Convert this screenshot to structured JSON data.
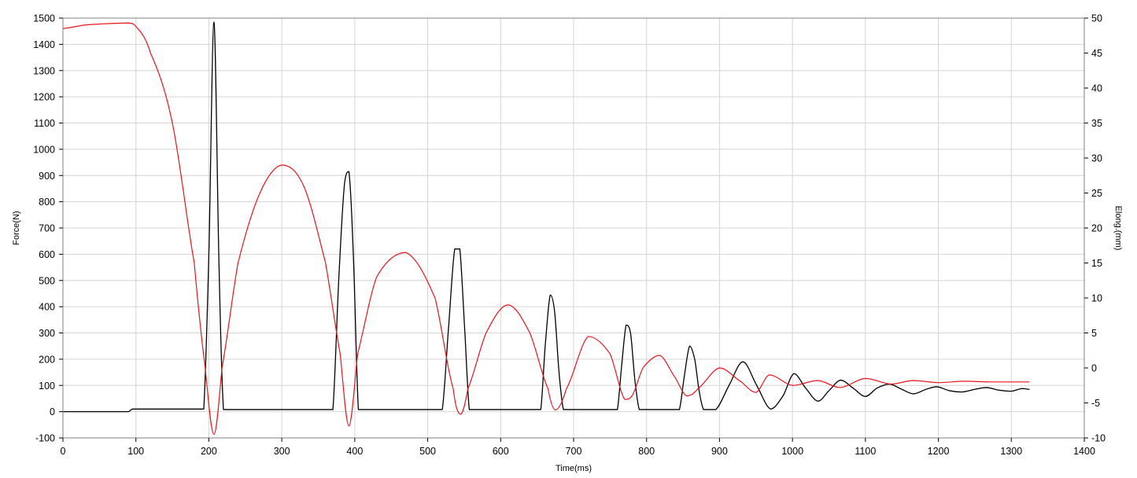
{
  "chart_data": {
    "type": "line",
    "xlabel": "Time(ms)",
    "ylabel_left": "Force(N)",
    "ylabel_right": "Elong.(mm)",
    "xlim": [
      0,
      1400
    ],
    "ylim_left": [
      -100,
      1500
    ],
    "ylim_right": [
      -10,
      50
    ],
    "x_ticks": [
      0,
      100,
      200,
      300,
      400,
      500,
      600,
      700,
      800,
      900,
      1000,
      1100,
      1200,
      1300,
      1400
    ],
    "y_left_ticks": [
      -100,
      0,
      100,
      200,
      300,
      400,
      500,
      600,
      700,
      800,
      900,
      1000,
      1100,
      1200,
      1300,
      1400,
      1500
    ],
    "y_right_ticks": [
      -10,
      -5,
      0,
      5,
      10,
      15,
      20,
      25,
      30,
      35,
      40,
      45,
      50
    ],
    "grid": true,
    "colors": {
      "force": "#000000",
      "elongation": "#e8141b",
      "grid": "#d4d4d4",
      "frame": "#808080"
    },
    "series": [
      {
        "axis": "left",
        "color": "#000000",
        "x": [
          0,
          90,
          95,
          190,
          193,
          200,
          207,
          214,
          220,
          225,
          370,
          378,
          386,
          392,
          398,
          405,
          410,
          520,
          528,
          537,
          544,
          551,
          557,
          563,
          655,
          661,
          668,
          674,
          680,
          686,
          760,
          766,
          772,
          778,
          784,
          790,
          845,
          852,
          859,
          866,
          872,
          878,
          895,
          913,
          932,
          951,
          970,
          987,
          1002,
          1018,
          1035,
          1050,
          1066,
          1083,
          1100,
          1116,
          1133,
          1150,
          1166,
          1183,
          1198,
          1215,
          1232,
          1250,
          1266,
          1283,
          1300,
          1315,
          1325
        ],
        "y": [
          0,
          0,
          10,
          10,
          10,
          600,
          1485,
          550,
          8,
          8,
          8,
          500,
          870,
          915,
          600,
          8,
          8,
          8,
          300,
          620,
          620,
          300,
          8,
          8,
          8,
          250,
          445,
          380,
          150,
          8,
          8,
          180,
          330,
          300,
          120,
          8,
          8,
          140,
          250,
          200,
          80,
          8,
          8,
          100,
          190,
          100,
          10,
          60,
          145,
          90,
          40,
          80,
          120,
          90,
          58,
          90,
          105,
          85,
          68,
          85,
          95,
          80,
          75,
          85,
          92,
          82,
          78,
          88,
          85
        ]
      },
      {
        "axis": "right",
        "color": "#e8141b",
        "x": [
          0,
          30,
          60,
          90,
          100,
          120,
          150,
          180,
          195,
          207,
          218,
          240,
          270,
          300,
          330,
          360,
          380,
          392,
          404,
          430,
          470,
          510,
          535,
          545,
          555,
          580,
          610,
          640,
          665,
          675,
          690,
          720,
          750,
          770,
          780,
          795,
          818,
          840,
          855,
          870,
          900,
          930,
          950,
          968,
          1000,
          1035,
          1065,
          1100,
          1135,
          1165,
          1200,
          1235,
          1270,
          1300,
          1325
        ],
        "y": [
          48.5,
          49,
          49.2,
          49.3,
          48.8,
          45,
          35,
          15,
          0,
          -9.5,
          0,
          15,
          25,
          29,
          26,
          15,
          2,
          -8.3,
          2,
          13,
          16.5,
          10,
          -3,
          -6.6,
          -3,
          5,
          9,
          5,
          -3,
          -6,
          -3,
          4.5,
          2,
          -4.5,
          -4,
          0,
          1.8,
          -1.5,
          -4,
          -3,
          0,
          -2,
          -3.5,
          -1,
          -2.5,
          -1.8,
          -2.8,
          -1.5,
          -2.3,
          -1.8,
          -2.1,
          -1.9,
          -2,
          -2,
          -2
        ]
      }
    ]
  }
}
